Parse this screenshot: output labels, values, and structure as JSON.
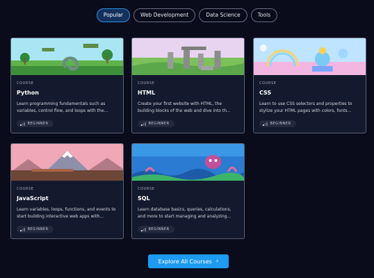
{
  "tabs": [
    {
      "label": "Popular",
      "active": true
    },
    {
      "label": "Web Development",
      "active": false
    },
    {
      "label": "Data Science",
      "active": false
    },
    {
      "label": "Tools",
      "active": false
    }
  ],
  "courses": [
    {
      "eyebrow": "COURSE",
      "title": "Python",
      "description": "Learn programming fundamentals such as variables, control flow, and loops with the...",
      "level": "BEGINNER"
    },
    {
      "eyebrow": "COURSE",
      "title": "HTML",
      "description": "Create your first website with HTML, the building blocks of the web and dive into th...",
      "level": "BEGINNER"
    },
    {
      "eyebrow": "COURSE",
      "title": "CSS",
      "description": "Learn to use CSS selectors and properties to stylize your HTML pages with colors, fonts...",
      "level": "BEGINNER"
    },
    {
      "eyebrow": "COURSE",
      "title": "JavaScript",
      "description": "Learn variables, loops, functions, and events to start building interactive web apps with...",
      "level": "BEGINNER"
    },
    {
      "eyebrow": "COURSE",
      "title": "SQL",
      "description": "Learn database basics, queries, calculations, and more to start managing and analyzing...",
      "level": "BEGINNER"
    }
  ],
  "cta": {
    "label": "Explore All Courses",
    "icon": "chevron-right-icon"
  },
  "colors": {
    "background": "#0a0b1b",
    "accent": "#1d9bf0",
    "card": "#141a2d"
  }
}
